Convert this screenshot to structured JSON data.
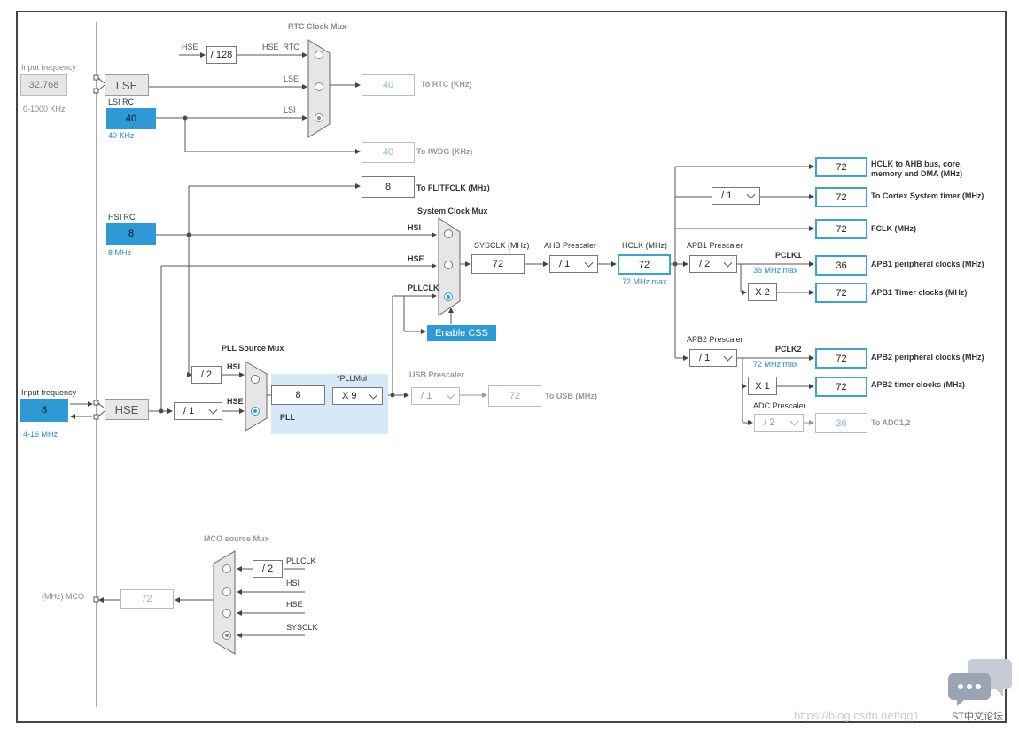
{
  "left": {
    "lse_input_label": "Input frequency",
    "lse_input_value": "32.768",
    "lse_range": "0-1000 KHz",
    "lse_label": "LSE",
    "lsi_rc_label": "LSI RC",
    "lsi_value": "40",
    "lsi_freq": "40 KHz",
    "hsi_rc_label": "HSI RC",
    "hsi_value": "8",
    "hsi_freq": "8 MHz",
    "hse_input_label": "Input frequency",
    "hse_input_value": "8",
    "hse_range": "4-16 MHz",
    "hse_label": "HSE",
    "mco_label": "(MHz) MCO",
    "mco_value": "72"
  },
  "rtc": {
    "title": "RTC Clock Mux",
    "hse_label": "HSE",
    "div_label": "/ 128",
    "hse_rtc_label": "HSE_RTC",
    "lse_label": "LSE",
    "lsi_label": "LSI",
    "rtc_value": "40",
    "rtc_label": "To RTC (KHz)",
    "iwdg_value": "40",
    "iwdg_label": "To IWDG (KHz)",
    "flit_value": "8",
    "flit_label": "To FLITFCLK (MHz)"
  },
  "sysmux": {
    "title": "System Clock Mux",
    "hsi": "HSI",
    "hse": "HSE",
    "pllclk": "PLLCLK",
    "enable_css": "Enable CSS",
    "sysclk_label": "SYSCLK (MHz)",
    "sysclk_value": "72",
    "ahb_label": "AHB Prescaler",
    "ahb_value": "/ 1",
    "hclk_label": "HCLK (MHz)",
    "hclk_value": "72",
    "hclk_max": "72 MHz max"
  },
  "pll": {
    "source_title": "PLL Source Mux",
    "hsi_div": "/ 2",
    "hsi": "HSI",
    "hse": "HSE",
    "hse_div": "/ 1",
    "input_value": "8",
    "mul_label": "*PLLMul",
    "mul_value": "X 9",
    "pll_label": "PLL"
  },
  "usb": {
    "label": "USB Prescaler",
    "div": "/ 1",
    "value": "72",
    "to": "To USB (MHz)"
  },
  "outputs": {
    "cortex_div": "/ 1",
    "hclk_ahb_value": "72",
    "hclk_ahb_label": "HCLK to AHB bus, core, memory and DMA (MHz)",
    "cortex_value": "72",
    "cortex_label": "To Cortex System timer (MHz)",
    "fclk_value": "72",
    "fclk_label": "FCLK (MHz)",
    "apb1_label": "APB1 Prescaler",
    "apb1_div": "/ 2",
    "pclk1_label": "PCLK1",
    "pclk1_max": "36 MHz max",
    "apb1_periph_value": "36",
    "apb1_periph_label": "APB1 peripheral clocks (MHz)",
    "apb1_timer_mul": "X 2",
    "apb1_timer_value": "72",
    "apb1_timer_label": "APB1 Timer clocks (MHz)",
    "apb2_label": "APB2 Prescaler",
    "apb2_div": "/ 1",
    "pclk2_label": "PCLK2",
    "pclk2_max": "72 MHz max",
    "apb2_periph_value": "72",
    "apb2_periph_label": "APB2 peripheral clocks (MHz)",
    "apb2_timer_mul": "X 1",
    "apb2_timer_value": "72",
    "apb2_timer_label": "APB2 timer clocks (MHz)",
    "adc_label": "ADC Prescaler",
    "adc_div": "/ 2",
    "adc_value": "36",
    "adc_to": "To ADC1,2"
  },
  "mco": {
    "title": "MCO source Mux",
    "pll_div": "/ 2",
    "pllclk": "PLLCLK",
    "hsi": "HSI",
    "hse": "HSE",
    "sysclk": "SYSCLK"
  },
  "watermark": "https://blog.csdn.net/qq1",
  "chat_label": "ST中文论坛",
  "colors": {
    "accent": "#2e9ad5",
    "output_border": "#3aa3cf",
    "pll_area": "#d6e9f7"
  }
}
